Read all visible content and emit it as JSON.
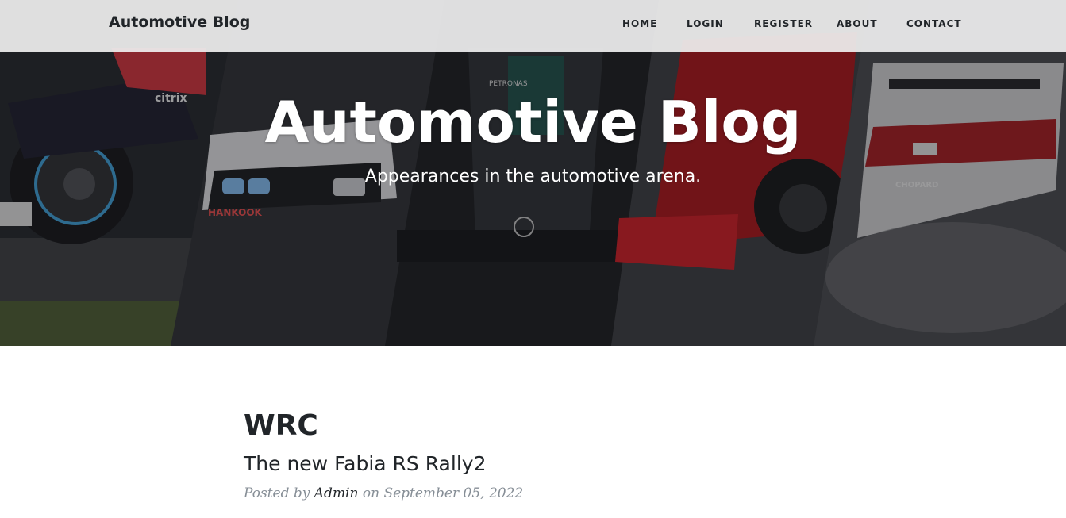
{
  "navbar": {
    "brand": "Automotive Blog",
    "links": [
      "HOME",
      "LOGIN",
      "REGISTER",
      "ABOUT",
      "CONTACT"
    ]
  },
  "hero": {
    "title": "Automotive Blog",
    "subtitle": "Appearances in the automotive arena.",
    "background_colors": [
      "#1f2124",
      "#2e3034",
      "#1b1d20",
      "#b3141b",
      "#3a3c40"
    ],
    "car_photo_labels": [
      "citrix",
      "HANKOOK",
      "PETRONAS",
      "CHOPARD"
    ]
  },
  "post": {
    "title": "WRC",
    "subtitle": "The new Fabia RS Rally2",
    "meta_prefix": "Posted by",
    "author": "Admin",
    "meta_on": "on",
    "date": "September 05, 2022"
  }
}
